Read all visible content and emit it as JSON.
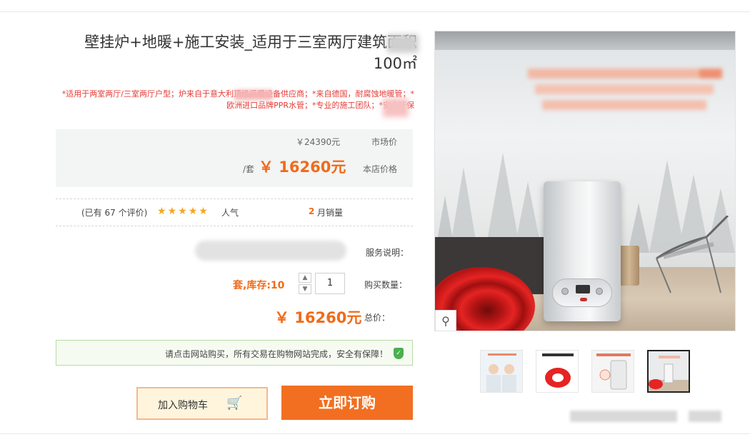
{
  "product": {
    "title": "壁挂炉+地暖+施工安装_适用于三室两厅建筑面积100㎡",
    "promo_text": "*适用于两室两厅/三室两厅户型；炉来自于意大利顶级采暖设备供应商；*来自德国，耐腐蚀地暖管；*欧洲进口品牌PPR水管；*专业的施工团队；*安全环保",
    "market_price_label": "市场价",
    "market_price": "￥24390元",
    "store_price_label": "本店价格",
    "store_price": "￥ 16260元",
    "store_price_unit": "/套",
    "monthly_sales_label": "月销量",
    "monthly_sales": "2",
    "popularity_label": "人气",
    "rating_count_text": "(已有 67 个评价)",
    "stars": 5,
    "service_label": "服务说明：",
    "qty_label": "购买数量：",
    "qty_value": "1",
    "stock_text": "套,库存:10",
    "total_label": "总价：",
    "total_price": "￥ 16260元",
    "notice": "请点击网站购买，所有交易在购物网站完成，安全有保障！",
    "buy_now": "立即订购",
    "add_to_cart": "加入购物车"
  },
  "gallery": {
    "zoom_icon": "search-icon",
    "thumbnails": [
      "workers-thumb",
      "red-pipe-thumb",
      "boiler-thumb",
      "room-scene-thumb"
    ],
    "active_thumb": 4
  },
  "colors": {
    "accent": "#f26f21",
    "promo_red": "#e53935",
    "notice_border": "#b7dba4",
    "star": "#f5a623"
  }
}
